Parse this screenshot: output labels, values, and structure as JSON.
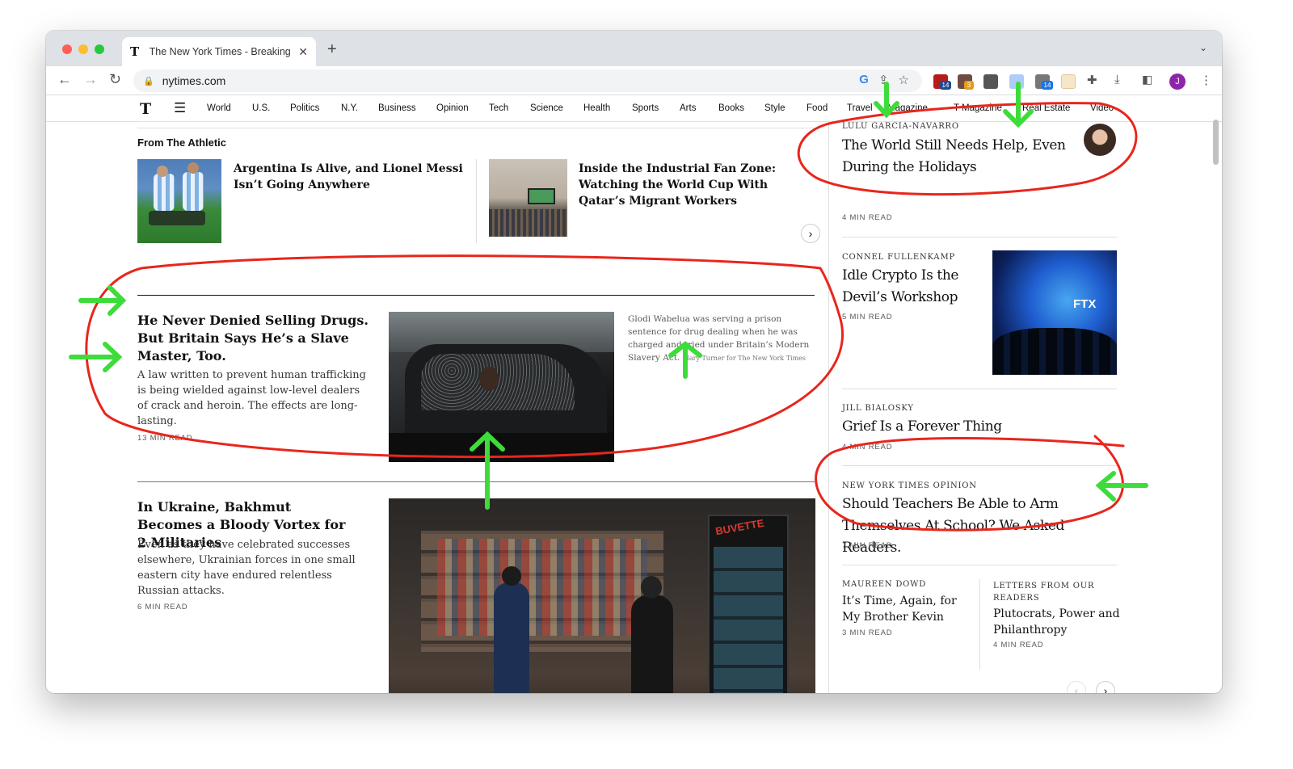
{
  "browser": {
    "tab_title": "The New York Times - Breaking News, US News, World News and Videos",
    "tab_favicon": "T",
    "new_tab_symbol": "+",
    "url": "nytimes.com",
    "profile_initial": "J",
    "extension_badges": [
      "14",
      "3",
      "14"
    ]
  },
  "nav": {
    "logo": "T",
    "items": [
      "World",
      "U.S.",
      "Politics",
      "N.Y.",
      "Business",
      "Opinion",
      "Tech",
      "Science",
      "Health",
      "Sports",
      "Arts",
      "Books",
      "Style",
      "Food",
      "Travel",
      "Magazine",
      "T Magazine",
      "Real Estate",
      "Video"
    ]
  },
  "athletic": {
    "label": "From The Athletic",
    "story1": "Argentina Is Alive, and Lionel Messi Isn’t Going Anywhere",
    "story2": "Inside the Industrial Fan Zone: Watching the World Cup With Qatar’s Migrant Workers"
  },
  "main_story": {
    "headline": "He Never Denied Selling Drugs. But Britain Says He’s a Slave Master, Too.",
    "summary": "A law written to prevent human trafficking is being wielded against low-level dealers of crack and heroin. The effects are long-lasting.",
    "read_time": "13 MIN READ",
    "caption": "Glodi Wabelua was serving a prison sentence for drug dealing when he was charged and tried under Britain’s Modern Slavery Act.",
    "credit": "Mary Turner for The New York Times"
  },
  "ukraine_story": {
    "headline": "In Ukraine, Bakhmut Becomes a Bloody Vortex for 2 Militaries",
    "summary": "Even as they have celebrated successes elsewhere, Ukrainian forces in one small eastern city have endured relentless Russian attacks.",
    "read_time": "6 MIN READ",
    "sign_text": "BUVETTE"
  },
  "opinion": [
    {
      "byline": "LULU GARCIA-NAVARRO",
      "headline": "The World Still Needs Help, Even During the Holidays",
      "read_time": "4 MIN READ"
    },
    {
      "byline": "CONNEL FULLENKAMP",
      "headline": "Idle Crypto Is the Devil’s Workshop",
      "read_time": "5 MIN READ",
      "image_text": "FTX"
    },
    {
      "byline": "JILL BIALOSKY",
      "headline": "Grief Is a Forever Thing",
      "read_time": "4 MIN READ"
    },
    {
      "byline": "NEW YORK TIMES OPINION",
      "headline": "Should Teachers Be Able to Arm Themselves At School? We Asked Readers.",
      "read_time": "7 MIN READ"
    },
    {
      "byline": "MAUREEN DOWD",
      "headline": "It’s Time, Again, for My Brother Kevin",
      "read_time": "3 MIN READ"
    },
    {
      "byline": "LETTERS FROM OUR READERS",
      "headline": "Plutocrats, Power and Philanthropy",
      "read_time": "4 MIN READ"
    }
  ],
  "colors": {
    "annotation_red": "#e8261c",
    "annotation_green": "#3ddc3a",
    "nyt_text": "#121212",
    "profile": "#8e24aa"
  }
}
